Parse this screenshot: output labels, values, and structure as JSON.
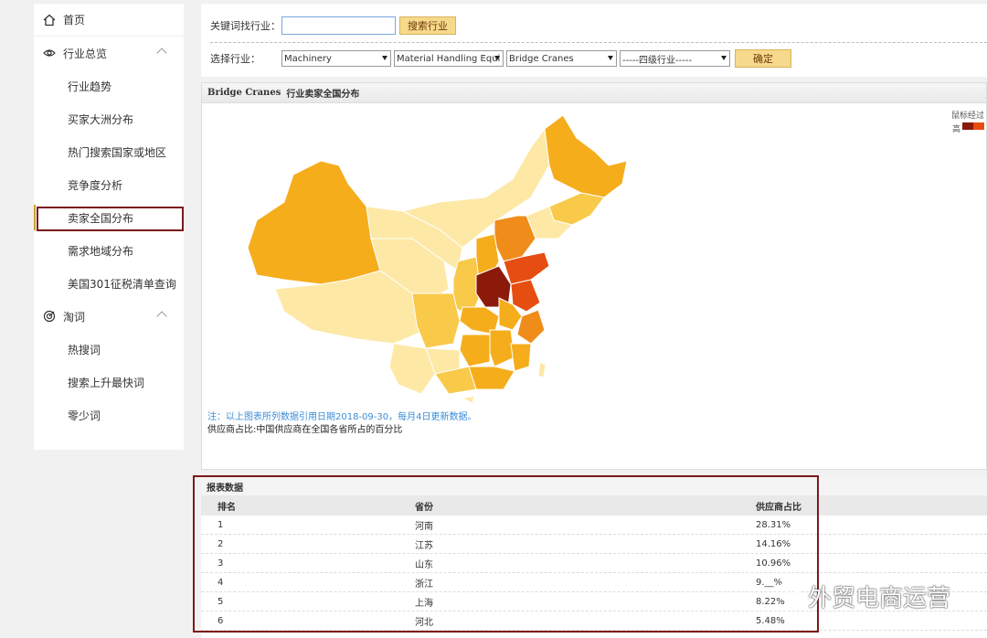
{
  "sidebar": {
    "home": "首页",
    "group1": "行业总览",
    "items": [
      "行业趋势",
      "买家大洲分布",
      "热门搜索国家或地区",
      "竞争度分析",
      "卖家全国分布",
      "需求地域分布",
      "美国301征税清单查询"
    ],
    "group2": "淘词",
    "items2": [
      "热搜词",
      "搜索上升最快词",
      "零少词"
    ]
  },
  "search": {
    "keyword_label": "关键词找行业：",
    "keyword_value": "",
    "search_button": "搜索行业",
    "select_label": "选择行业：",
    "level1": "Machinery",
    "level2": "Material Handling Equi",
    "level3": "Bridge Cranes",
    "level4": "-----四级行业-----",
    "confirm_button": "确定"
  },
  "map": {
    "title_en": "Bridge Cranes",
    "title_cn": "行业卖家全国分布",
    "legend_text": "鼠标经过",
    "legend_high": "高",
    "note": "注：以上图表所列数据引用日期2018-09-30，每月4日更新数据。",
    "note2": "供应商占比:中国供应商在全国各省所占的百分比",
    "colors": {
      "darkest": "#8b1a0a",
      "dark": "#e64d10",
      "mid": "#f08c1a",
      "light": "#f5ad1c",
      "lighter": "#f9c94a",
      "lightest": "#fde8a6"
    }
  },
  "table": {
    "title": "报表数据",
    "headers": [
      "排名",
      "省份",
      "供应商占比"
    ],
    "rows": [
      [
        "1",
        "河南",
        "28.31%"
      ],
      [
        "2",
        "江苏",
        "14.16%"
      ],
      [
        "3",
        "山东",
        "10.96%"
      ],
      [
        "4",
        "浙江",
        "9.__%"
      ],
      [
        "5",
        "上海",
        "8.22%"
      ],
      [
        "6",
        "河北",
        "5.48%"
      ]
    ]
  },
  "watermark": "外贸电商运营"
}
